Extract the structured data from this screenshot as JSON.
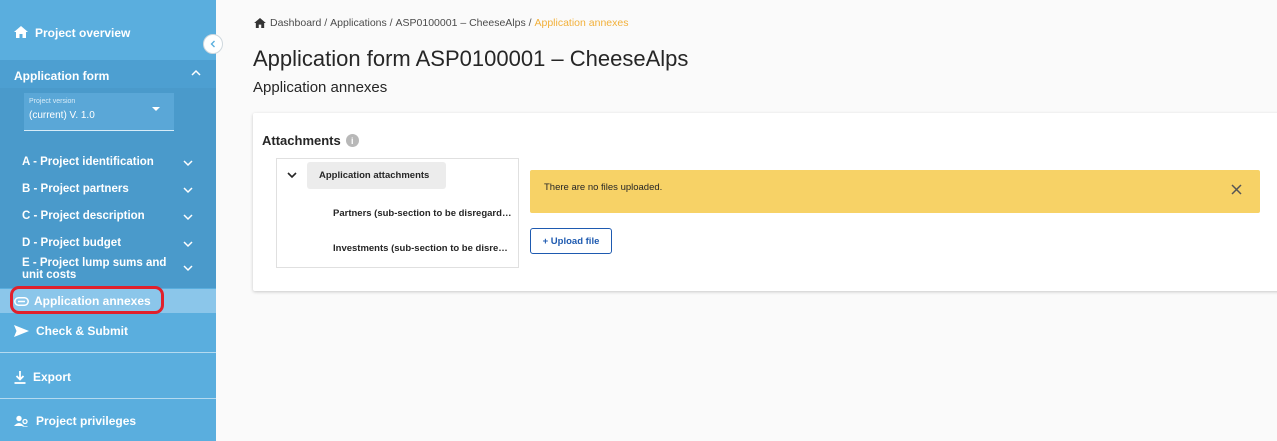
{
  "sidebar": {
    "project_overview": "Project overview",
    "application_form": "Application form",
    "version": {
      "caption": "Project version",
      "value": "(current) V. 1.0"
    },
    "sections": [
      {
        "label": "A - Project identification"
      },
      {
        "label": "B - Project partners"
      },
      {
        "label": "C - Project description"
      },
      {
        "label": "D - Project budget"
      },
      {
        "label": "E - Project lump sums and unit costs"
      }
    ],
    "application_annexes": "Application annexes",
    "check_submit": "Check & Submit",
    "export": "Export",
    "project_privileges": "Project privileges"
  },
  "breadcrumb": {
    "dashboard": "Dashboard",
    "sep": " / ",
    "applications": "Applications",
    "project": "ASP0100001 – CheeseAlps",
    "current": "Application annexes"
  },
  "header": {
    "title": "Application form ASP0100001 – CheeseAlps",
    "subtitle": "Application annexes"
  },
  "attachments": {
    "title": "Attachments",
    "info_glyph": "i",
    "tree": {
      "root": "Application attachments",
      "children": [
        "Partners (sub-section to be disregarded)",
        "Investments (sub-section to be disregarded)"
      ]
    },
    "alert_text": "There are no files uploaded.",
    "upload_label": "+ Upload file"
  },
  "colors": {
    "sidebar": "#5aaede",
    "sidebar_active": "#8bc6ea",
    "highlight": "#e0202c",
    "alert": "#f7d266",
    "breadcrumb_active": "#f2b03a",
    "primary": "#1e5ab0"
  }
}
